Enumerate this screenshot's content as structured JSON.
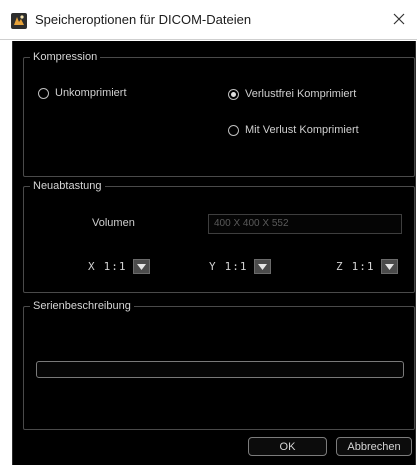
{
  "window": {
    "title": "Speicheroptionen für DICOM-Dateien",
    "icon": "dicom-app-icon",
    "close_icon": "close-icon"
  },
  "compression": {
    "title": "Kompression",
    "options": [
      {
        "label": "Unkomprimiert",
        "checked": false
      },
      {
        "label": "Verlustfrei Komprimiert",
        "checked": true
      },
      {
        "label": "Mit Verlust Komprimiert",
        "checked": false
      }
    ]
  },
  "resampling": {
    "title": "Neuabtastung",
    "volume_label": "Volumen",
    "volume_value": "400 X 400 X 552",
    "axes": [
      {
        "letter": "X",
        "value": "1:1"
      },
      {
        "letter": "Y",
        "value": "1:1"
      },
      {
        "letter": "Z",
        "value": "1:1"
      }
    ]
  },
  "series": {
    "title": "Serienbeschreibung",
    "value": ""
  },
  "buttons": {
    "ok": "OK",
    "cancel": "Abbrechen"
  },
  "colors": {
    "dialog_background": "#000000",
    "title_bar": "#ffffff",
    "group_border": "#4a4a4a"
  }
}
